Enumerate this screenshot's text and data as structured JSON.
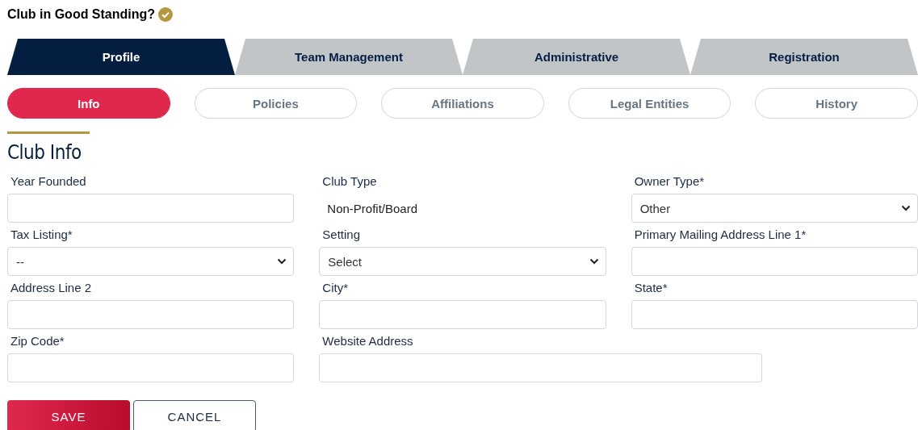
{
  "header": {
    "title": "Club in Good Standing?",
    "good_standing": true
  },
  "tabs": [
    {
      "label": "Profile",
      "selected": true
    },
    {
      "label": "Team Management",
      "selected": false
    },
    {
      "label": "Administrative",
      "selected": false
    },
    {
      "label": "Registration",
      "selected": false
    }
  ],
  "subtabs": [
    {
      "label": "Info",
      "selected": true
    },
    {
      "label": "Policies",
      "selected": false
    },
    {
      "label": "Affiliations",
      "selected": false
    },
    {
      "label": "Legal Entities",
      "selected": false
    },
    {
      "label": "History",
      "selected": false
    }
  ],
  "section": {
    "title": "Club Info"
  },
  "fields": [
    {
      "label": "Year Founded",
      "kind": "text"
    },
    {
      "label": "Club Type",
      "kind": "static",
      "value": "Non-Profit/Board"
    },
    {
      "label": "Owner Type*",
      "kind": "select",
      "value": "Other"
    },
    {
      "label": "Tax Listing*",
      "kind": "select",
      "value": "--"
    },
    {
      "label": "Setting",
      "kind": "select",
      "value": "Select"
    },
    {
      "label": "Primary Mailing Address Line 1*",
      "kind": "text"
    },
    {
      "label": "Address Line 2",
      "kind": "text"
    },
    {
      "label": "City*",
      "kind": "text"
    },
    {
      "label": "State*",
      "kind": "text"
    },
    {
      "label": "Zip Code*",
      "kind": "text"
    },
    {
      "label": "Website Address",
      "kind": "wide-text"
    }
  ],
  "buttons": [
    {
      "label": "SAVE",
      "kind": "primary"
    },
    {
      "label": "CANCEL",
      "kind": "secondary"
    }
  ]
}
